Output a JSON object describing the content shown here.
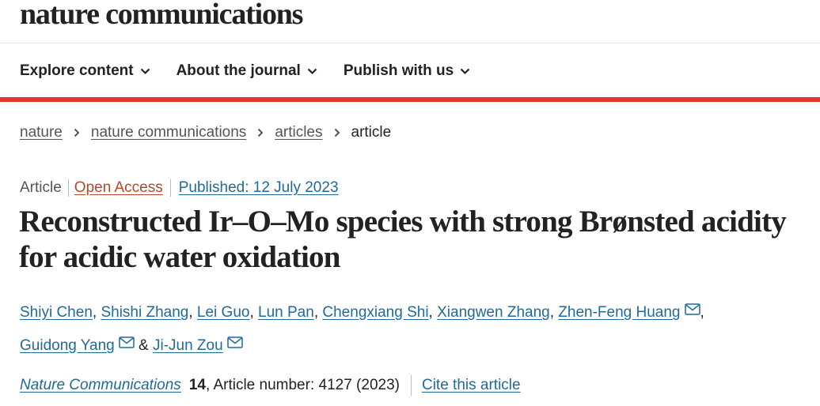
{
  "header": {
    "logo": "nature communications"
  },
  "nav": {
    "items": [
      {
        "label": "Explore content"
      },
      {
        "label": "About the journal"
      },
      {
        "label": "Publish with us"
      }
    ],
    "icon": "chevron-down-icon"
  },
  "breadcrumb": {
    "items": [
      "nature",
      "nature communications",
      "articles"
    ],
    "current": "article",
    "separator_icon": "chevron-right-icon"
  },
  "article": {
    "type": "Article",
    "access": "Open Access",
    "published": "Published: 12 July 2023",
    "title": "Reconstructed Ir–O–Mo species with strong Brønsted acidity for acidic water oxidation",
    "authors": [
      {
        "name": "Shiyi Chen",
        "after": ", "
      },
      {
        "name": "Shishi Zhang",
        "after": ", "
      },
      {
        "name": "Lei Guo",
        "after": ", "
      },
      {
        "name": "Lun Pan",
        "after": ", "
      },
      {
        "name": "Chengxiang Shi",
        "after": ", "
      },
      {
        "name": "Xiangwen Zhang",
        "after": ", "
      },
      {
        "name": "Zhen-Feng Huang",
        "after": ","
      },
      {
        "name": "Guidong Yang",
        "after": " & "
      },
      {
        "name": "Ji-Jun Zou",
        "after": ""
      }
    ],
    "citation": {
      "journal": "Nature Communications",
      "volume": "14",
      "article_number": ", Article number: 4127 (2023)",
      "cite_label": "Cite this article"
    }
  },
  "colors": {
    "accent_red": "#e0382c",
    "link_blue": "#1f6a9a",
    "open_access": "#b8472a"
  }
}
